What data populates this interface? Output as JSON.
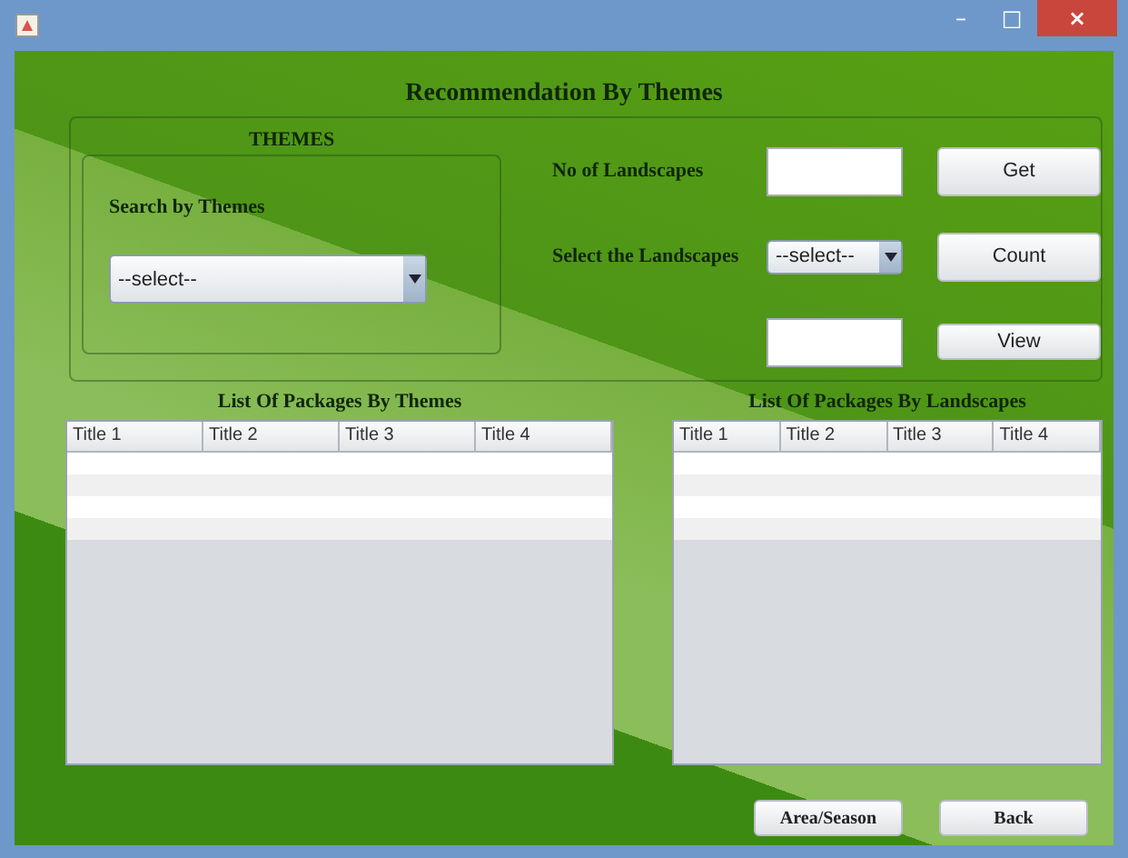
{
  "window": {
    "controls": [
      "–",
      "□",
      "×"
    ]
  },
  "heading": "Recommendation By Themes",
  "themes_panel": {
    "title": "THEMES",
    "label": "Search by Themes",
    "dropdown": {
      "value": "--select--"
    }
  },
  "landscapes": {
    "count_label": "No of Landscapes",
    "select_label": "Select the Landscapes",
    "dropdown": {
      "value": "--select--"
    },
    "buttons": [
      "Get",
      "Count",
      "View"
    ]
  },
  "tables": [
    {
      "title": "List Of Packages By Themes",
      "columns": [
        "Title 1",
        "Title 2",
        "Title 3",
        "Title 4"
      ]
    },
    {
      "title": "List Of Packages By Landscapes",
      "columns": [
        "Title 1",
        "Title 2",
        "Title 3",
        "Title 4"
      ]
    }
  ],
  "footer_buttons": [
    "Area/Season",
    "Back"
  ]
}
